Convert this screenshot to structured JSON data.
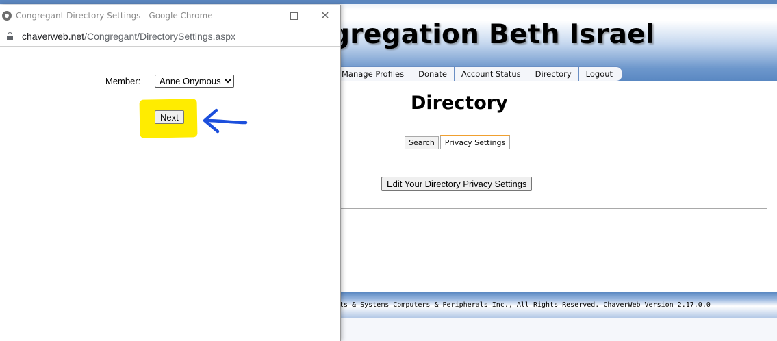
{
  "background_page": {
    "site_title": "ngregation Beth Israel",
    "nav": [
      "Manage Profiles",
      "Donate",
      "Account Status",
      "Directory",
      "Logout"
    ],
    "page_title": "Directory",
    "tabs": [
      "Search",
      "Privacy Settings"
    ],
    "active_tab": "Privacy Settings",
    "edit_button_label": "Edit Your Directory Privacy Settings",
    "footer_text": "ts & Systems Computers & Peripherals Inc., All Rights Reserved. ChaverWeb Version 2.17.0.0"
  },
  "popup": {
    "window_title": "Congregant Directory Settings - Google Chrome",
    "url_host": "chaverweb.net",
    "url_path": "/Congregant/DirectorySettings.aspx",
    "member_label": "Member:",
    "member_selected": "Anne Onymous",
    "next_button_label": "Next",
    "highlight_color": "#ffec00",
    "arrow_color": "#1c4fdc"
  }
}
